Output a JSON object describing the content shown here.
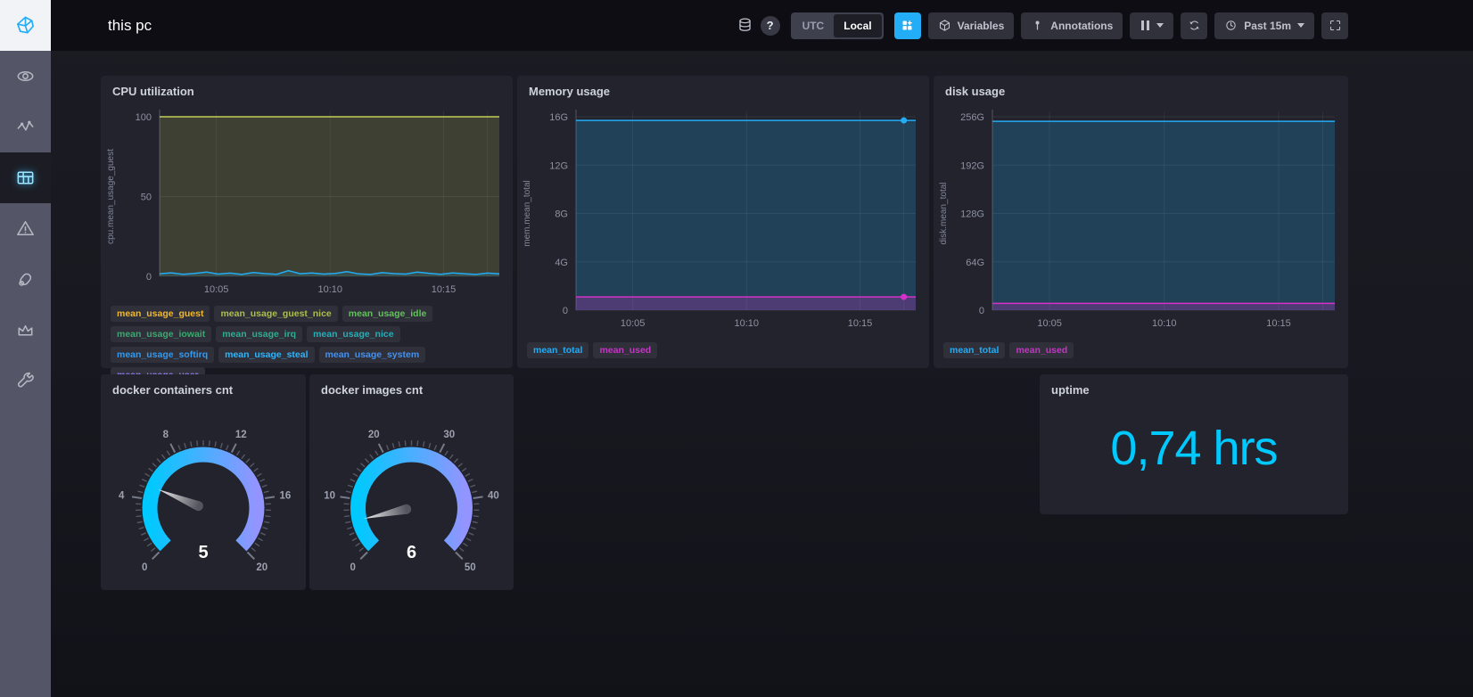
{
  "header": {
    "title": "this pc",
    "help_glyph": "?",
    "timezone_toggle": {
      "utc": "UTC",
      "local": "Local",
      "selected": "Local"
    },
    "variables_label": "Variables",
    "annotations_label": "Annotations",
    "time_range_label": "Past 15m"
  },
  "sidebar": {
    "items": [
      "chronograf-logo",
      "host-list",
      "data-explorer",
      "dashboards",
      "alerts",
      "kapacitor",
      "admin",
      "configuration"
    ],
    "active": "dashboards"
  },
  "colors": {
    "accent_blue": "#22ADF6",
    "gauge_start": "#00C9FF",
    "gauge_end": "#9394FF",
    "magenta": "#D531C9",
    "yellow_green": "#C3CE58",
    "panel_bg": "#22232c",
    "header_bg": "#0e0d14",
    "sidebar_bg": "#545667"
  },
  "chart_data": [
    {
      "id": "cpu",
      "type": "line",
      "title": "CPU utilization",
      "ylabel": "cpu.mean_usage_guest",
      "ylim": [
        0,
        100
      ],
      "y_ticks": [
        {
          "v": 100,
          "label": "100"
        },
        {
          "v": 50,
          "label": "50"
        },
        {
          "v": 0,
          "label": "0"
        }
      ],
      "x_ticks": [
        {
          "f": 0.167,
          "label": "10:05"
        },
        {
          "f": 0.502,
          "label": "10:10"
        },
        {
          "f": 0.836,
          "label": "10:15"
        },
        {
          "f": 0.965,
          "label": ""
        }
      ],
      "series": [
        {
          "name": "mean_usage_idle",
          "color": "#C3CE58",
          "fill_opacity": 0.17,
          "values": [
            100,
            100
          ]
        },
        {
          "name": "mean_usage_system",
          "color": "#22ADF6",
          "fill_opacity": 0.12,
          "values": [
            1.6,
            2.2,
            1.3,
            1.8,
            2.7,
            1.4,
            2.0,
            1.2,
            2.4,
            1.7,
            1.3,
            3.6,
            1.6,
            2.1,
            1.4,
            1.8,
            2.9,
            1.5,
            1.2,
            2.3,
            1.7,
            1.4,
            2.6,
            1.9,
            1.3,
            2.1,
            1.6,
            1.2,
            2.0,
            1.5
          ]
        }
      ],
      "legend": [
        {
          "label": "mean_usage_guest",
          "color": "#F2B827"
        },
        {
          "label": "mean_usage_guest_nice",
          "color": "#AEBE4B"
        },
        {
          "label": "mean_usage_idle",
          "color": "#61C25A"
        },
        {
          "label": "mean_usage_iowait",
          "color": "#3AA96F"
        },
        {
          "label": "mean_usage_irq",
          "color": "#2BAE92"
        },
        {
          "label": "mean_usage_nice",
          "color": "#22B0B8"
        },
        {
          "label": "mean_usage_softirq",
          "color": "#2E9BF4"
        },
        {
          "label": "mean_usage_steal",
          "color": "#31B3F7"
        },
        {
          "label": "mean_usage_system",
          "color": "#4591ED"
        },
        {
          "label": "mean_usage_user",
          "color": "#8B7CEF"
        }
      ]
    },
    {
      "id": "mem",
      "type": "line",
      "title": "Memory usage",
      "ylabel": "mem.mean_total",
      "ylim": [
        0,
        16
      ],
      "y_ticks": [
        {
          "v": 16,
          "label": "16G"
        },
        {
          "v": 12,
          "label": "12G"
        },
        {
          "v": 8,
          "label": "8G"
        },
        {
          "v": 4,
          "label": "4G"
        },
        {
          "v": 0,
          "label": "0"
        }
      ],
      "x_ticks": [
        {
          "f": 0.167,
          "label": "10:05"
        },
        {
          "f": 0.502,
          "label": "10:10"
        },
        {
          "f": 0.836,
          "label": "10:15"
        },
        {
          "f": 0.965,
          "label": ""
        }
      ],
      "series": [
        {
          "name": "mean_total",
          "color": "#22ADF6",
          "fill_opacity": 0.22,
          "values": [
            15.7,
            15.7
          ],
          "end_dot": true
        },
        {
          "name": "mean_used",
          "color": "#D531C9",
          "fill_opacity": 0.25,
          "values": [
            1.1,
            1.1
          ],
          "end_dot": true
        }
      ],
      "legend": [
        {
          "label": "mean_total",
          "color": "#22ADF6"
        },
        {
          "label": "mean_used",
          "color": "#C436C4"
        }
      ]
    },
    {
      "id": "disk",
      "type": "line",
      "title": "disk usage",
      "ylabel": "disk.mean_total",
      "ylim": [
        0,
        256
      ],
      "y_ticks": [
        {
          "v": 256,
          "label": "256G"
        },
        {
          "v": 192,
          "label": "192G"
        },
        {
          "v": 128,
          "label": "128G"
        },
        {
          "v": 64,
          "label": "64G"
        },
        {
          "v": 0,
          "label": "0"
        }
      ],
      "x_ticks": [
        {
          "f": 0.167,
          "label": "10:05"
        },
        {
          "f": 0.502,
          "label": "10:10"
        },
        {
          "f": 0.836,
          "label": "10:15"
        },
        {
          "f": 0.965,
          "label": ""
        }
      ],
      "series": [
        {
          "name": "mean_total",
          "color": "#22ADF6",
          "fill_opacity": 0.22,
          "values": [
            250,
            250
          ]
        },
        {
          "name": "mean_used",
          "color": "#D531C9",
          "fill_opacity": 0.25,
          "values": [
            9,
            9
          ]
        }
      ],
      "legend": [
        {
          "label": "mean_total",
          "color": "#22ADF6"
        },
        {
          "label": "mean_used",
          "color": "#C436C4"
        }
      ]
    },
    {
      "id": "gauge-containers",
      "type": "gauge",
      "title": "docker containers cnt",
      "min": 0,
      "max": 20,
      "value": 5,
      "display_value": "5",
      "tick_labels": [
        "0",
        "4",
        "8",
        "12",
        "16",
        "20"
      ]
    },
    {
      "id": "gauge-images",
      "type": "gauge",
      "title": "docker images cnt",
      "min": 0,
      "max": 50,
      "value": 6,
      "display_value": "6",
      "tick_labels": [
        "0",
        "10",
        "20",
        "30",
        "40",
        "50"
      ]
    },
    {
      "id": "uptime",
      "type": "single_stat",
      "title": "uptime",
      "value": "0,74",
      "suffix": " hrs",
      "color": "#00C9FF"
    }
  ]
}
